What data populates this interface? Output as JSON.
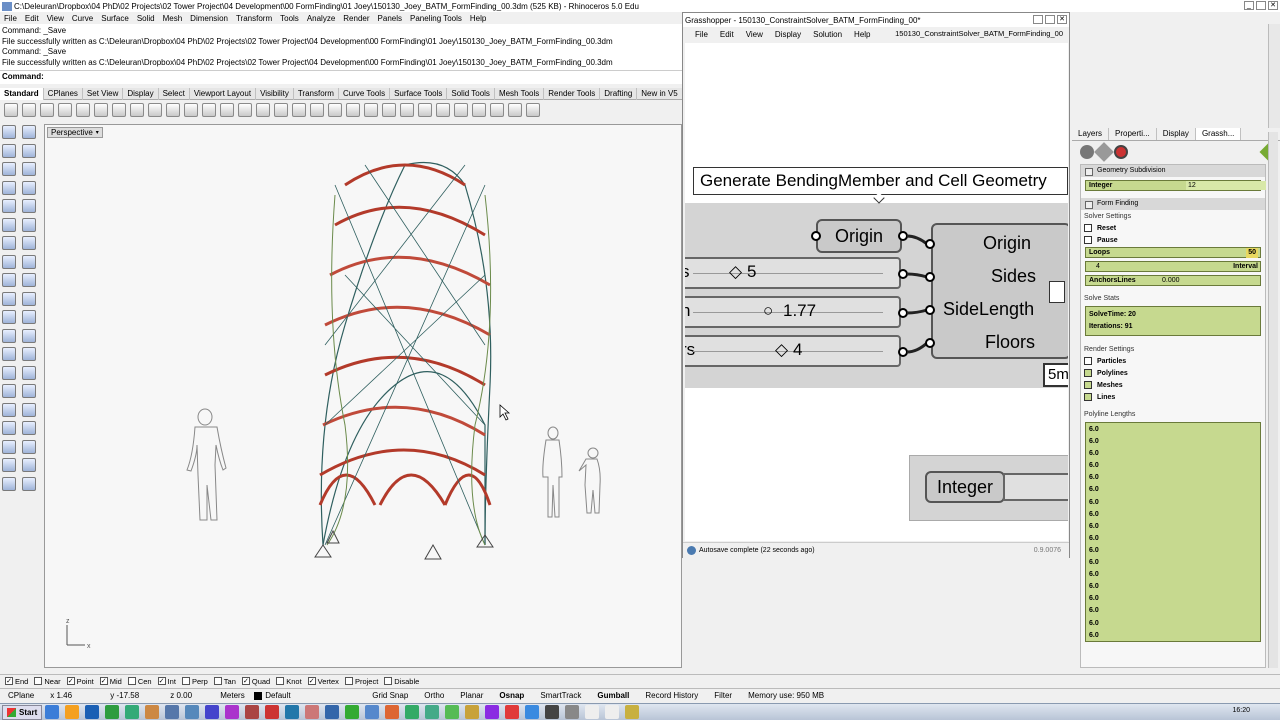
{
  "rhino": {
    "title": "C:\\Deleuran\\Dropbox\\04 PhD\\02 Projects\\02 Tower Project\\04 Development\\00 FormFinding\\01 Joey\\150130_Joey_BATM_FormFinding_00.3dm (525 KB) - Rhinoceros 5.0 Edu",
    "menu": [
      "File",
      "Edit",
      "View",
      "Curve",
      "Surface",
      "Solid",
      "Mesh",
      "Dimension",
      "Transform",
      "Tools",
      "Analyze",
      "Render",
      "Panels",
      "Paneling Tools",
      "Help"
    ],
    "history": [
      "Command: _Save",
      "File successfully written as C:\\Deleuran\\Dropbox\\04 PhD\\02 Projects\\02 Tower Project\\04 Development\\00 FormFinding\\01 Joey\\150130_Joey_BATM_FormFinding_00.3dm",
      "Command: _Save",
      "File successfully written as C:\\Deleuran\\Dropbox\\04 PhD\\02 Projects\\02 Tower Project\\04 Development\\00 FormFinding\\01 Joey\\150130_Joey_BATM_FormFinding_00.3dm"
    ],
    "command_prompt": "Command:",
    "toolbar_tabs": [
      "Standard",
      "CPlanes",
      "Set View",
      "Display",
      "Select",
      "Viewport Layout",
      "Visibility",
      "Transform",
      "Curve Tools",
      "Surface Tools",
      "Solid Tools",
      "Mesh Tools",
      "Render Tools",
      "Drafting",
      "New in V5"
    ],
    "viewport_label": "Perspective",
    "axis_x": "x",
    "axis_z": "z",
    "osnaps": [
      {
        "label": "End",
        "checked": true
      },
      {
        "label": "Near",
        "checked": false
      },
      {
        "label": "Point",
        "checked": true
      },
      {
        "label": "Mid",
        "checked": true
      },
      {
        "label": "Cen",
        "checked": false
      },
      {
        "label": "Int",
        "checked": true
      },
      {
        "label": "Perp",
        "checked": false
      },
      {
        "label": "Tan",
        "checked": false
      },
      {
        "label": "Quad",
        "checked": true
      },
      {
        "label": "Knot",
        "checked": false
      },
      {
        "label": "Vertex",
        "checked": true
      },
      {
        "label": "Project",
        "checked": false
      },
      {
        "label": "Disable",
        "checked": false
      }
    ],
    "status": {
      "cplane": "CPlane",
      "x": "x 1.46",
      "y": "y -17.58",
      "z": "z 0.00",
      "units": "Meters",
      "layer": "Default",
      "grid_snap": "Grid Snap",
      "ortho": "Ortho",
      "planar": "Planar",
      "osnap": "Osnap",
      "smarttrack": "SmartTrack",
      "gumball": "Gumball",
      "record_history": "Record History",
      "filter": "Filter",
      "memory": "Memory use: 950 MB"
    }
  },
  "grasshopper": {
    "title": "Grasshopper - 150130_ConstraintSolver_BATM_FormFinding_00*",
    "menu": [
      "File",
      "Edit",
      "View",
      "Display",
      "Solution",
      "Help"
    ],
    "doc_name": "150130_ConstraintSolver_BATM_FormFinding_00",
    "group_title": "Generate BendingMember and Cell Geometry",
    "origin_param": "Origin",
    "sliders": [
      {
        "left_label": "s",
        "value": "5"
      },
      {
        "left_label": "h",
        "value": "1.77"
      },
      {
        "left_label": "rs",
        "value": "4"
      }
    ],
    "component_inputs": [
      "Origin",
      "Sides",
      "SideLength",
      "Floors"
    ],
    "timer_label": "5m",
    "integer_param": "Integer",
    "status_msg": "Autosave complete (22 seconds ago)",
    "version": "0.9.0076"
  },
  "right_panel": {
    "tabs": [
      "Layers",
      "Properti...",
      "Display",
      "Grassh..."
    ],
    "geometry_subdivision": {
      "title": "Geometry Subdivision",
      "integer_label": "Integer",
      "integer_value": "12"
    },
    "form_finding": {
      "title": "Form Finding",
      "solver_settings": "Solver Settings",
      "reset": "Reset",
      "pause": "Pause",
      "loops_label": "Loops",
      "loops_value": "50",
      "interval_value": "4",
      "interval_label": "Interval",
      "anchors_label": "AnchorsLines",
      "anchors_value": "0.000",
      "solve_stats": "Solve Stats",
      "solve_time": "SolveTime: 20",
      "iterations": "Iterations: 91",
      "render_settings": "Render Settings",
      "render_options": [
        {
          "label": "Particles",
          "checked": false
        },
        {
          "label": "Polylines",
          "checked": true
        },
        {
          "label": "Meshes",
          "checked": true
        },
        {
          "label": "Lines",
          "checked": true
        }
      ],
      "polyline_lengths": "Polyline Lengths",
      "lengths": [
        "6.0",
        "6.0",
        "6.0",
        "6.0",
        "6.0",
        "6.0",
        "6.0",
        "6.0",
        "6.0",
        "6.0",
        "6.0",
        "6.0",
        "6.0",
        "6.0",
        "6.0",
        "6.0",
        "6.0",
        "6.0"
      ]
    }
  },
  "taskbar": {
    "start": "Start",
    "time": "16:20"
  },
  "colors": {
    "gh_canvas": "#d4d4d4",
    "panel_green": "#c6d98f",
    "tower_red": "#b33a2a",
    "tower_teal": "#2f5f5f"
  }
}
